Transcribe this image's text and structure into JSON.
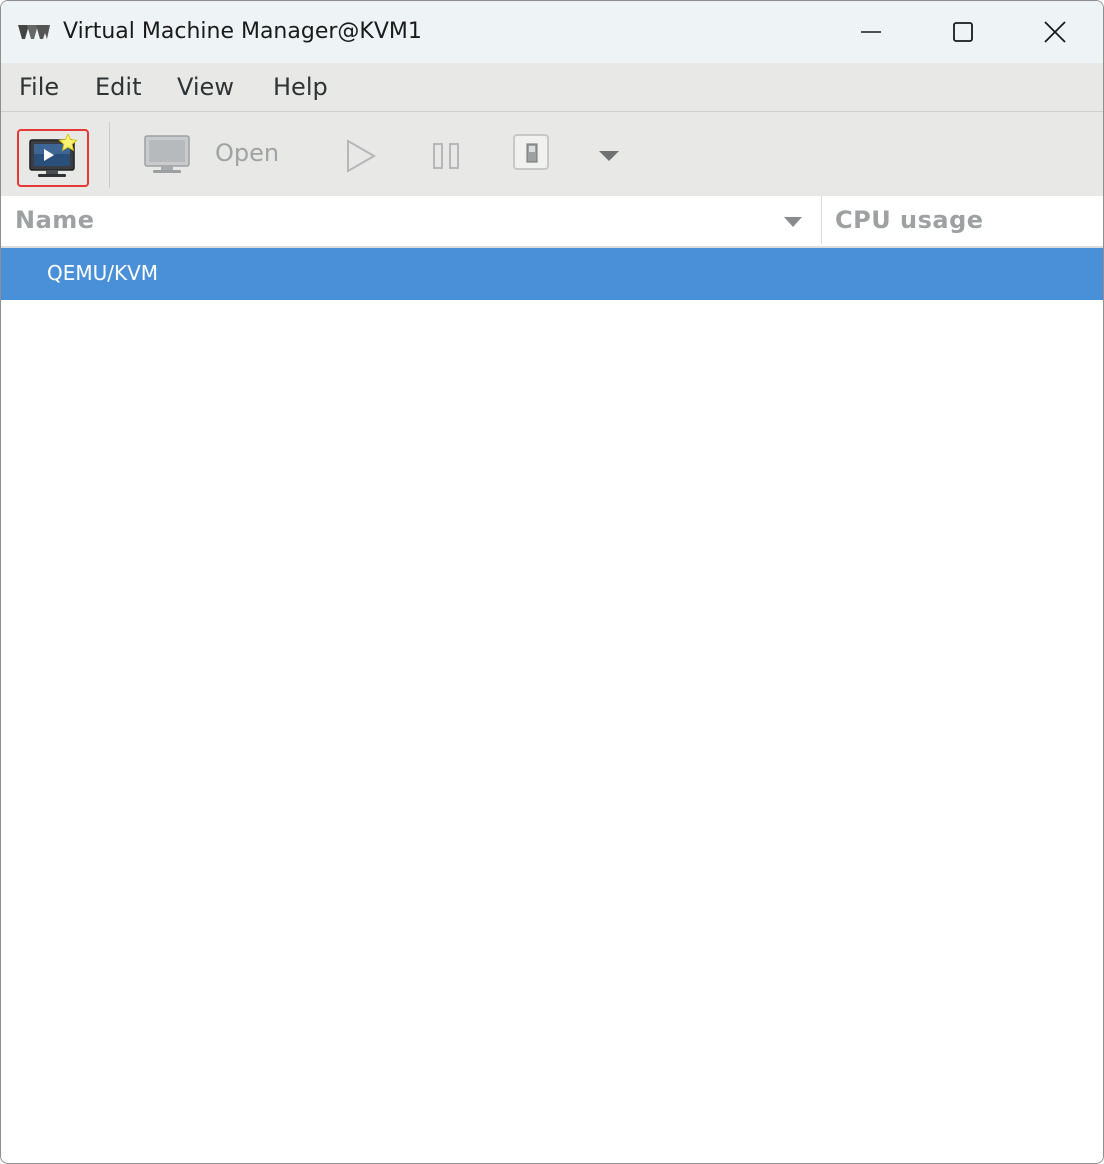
{
  "window": {
    "title": "Virtual Machine Manager@KVM1",
    "controls": [
      "minimize",
      "maximize",
      "close"
    ]
  },
  "menu": {
    "items": [
      "File",
      "Edit",
      "View",
      "Help"
    ]
  },
  "toolbar": {
    "new_vm_icon": "new-vm-icon",
    "open_label": "Open",
    "run_icon": "play-icon",
    "pause_icon": "pause-icon",
    "shutdown_icon": "shutdown-icon",
    "more_icon": "chevron-down-icon"
  },
  "table": {
    "columns": [
      "Name",
      "CPU usage"
    ],
    "rows": [
      {
        "name": "QEMU/KVM",
        "cpu_usage": "",
        "selected": true
      }
    ]
  },
  "colors": {
    "selection": "#4a90d9",
    "highlight_border": "#e53935",
    "toolbar_bg": "#e8e8e7",
    "titlebar_bg": "#eef3f6"
  }
}
